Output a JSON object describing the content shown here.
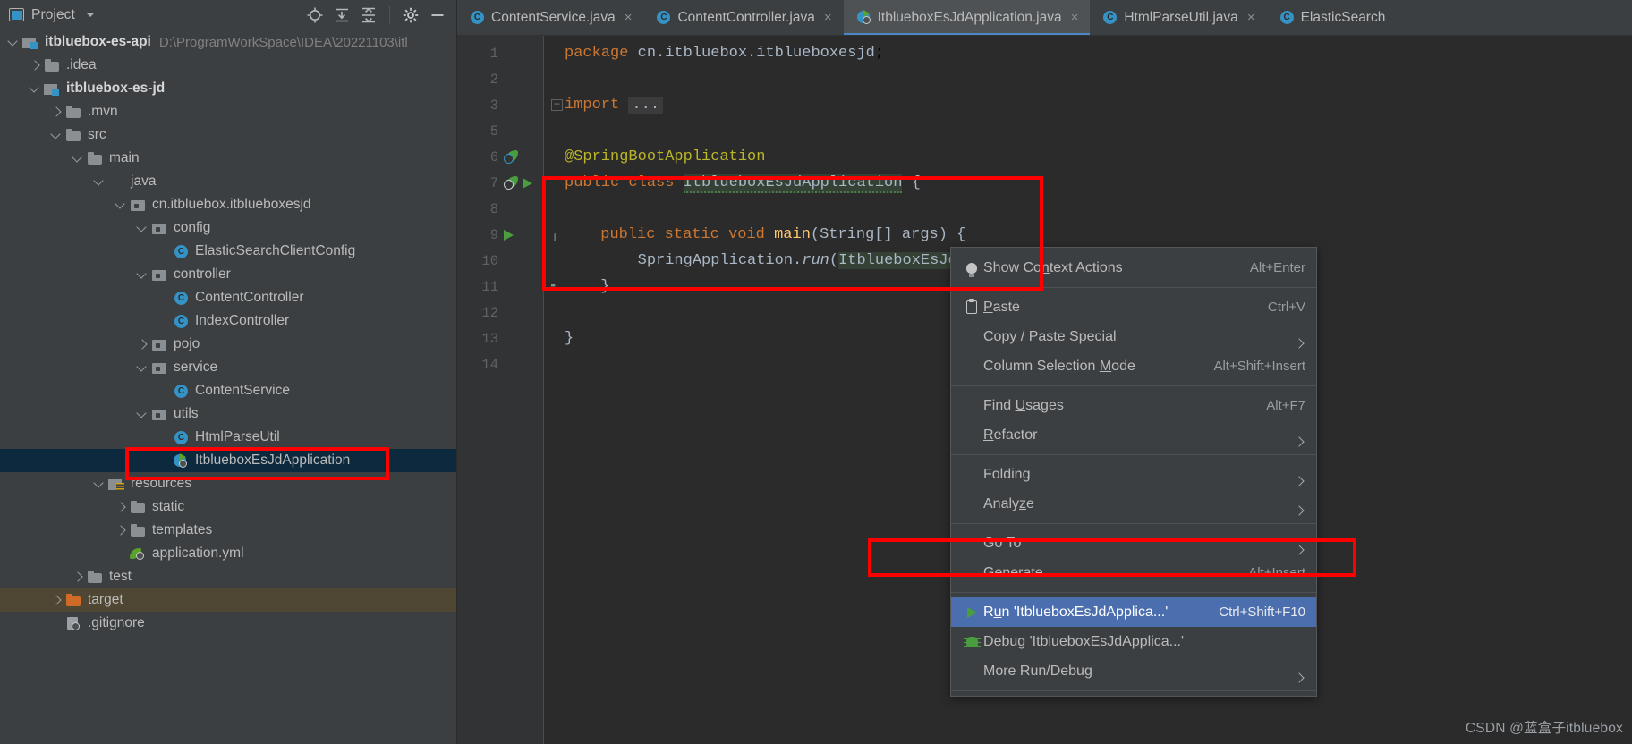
{
  "project_panel": {
    "title": "Project",
    "title_icon": "project-view-icon",
    "toolbar": [
      {
        "name": "locate-icon",
        "label": ""
      },
      {
        "name": "expand-all-icon",
        "label": ""
      },
      {
        "name": "collapse-all-icon",
        "label": ""
      },
      {
        "name": "gear-icon",
        "label": ""
      },
      {
        "name": "minimize-icon",
        "label": ""
      }
    ],
    "tree": [
      {
        "indent": 0,
        "arrow": "open",
        "icon": "module",
        "label": "itbluebox-es-api",
        "bold": true,
        "path": "D:\\ProgramWorkSpace\\IDEA\\20221103\\itl"
      },
      {
        "indent": 1,
        "arrow": "closed",
        "icon": "folder",
        "label": ".idea",
        "bold": false,
        "path": ""
      },
      {
        "indent": 1,
        "arrow": "open",
        "icon": "module",
        "label": "itbluebox-es-jd",
        "bold": true,
        "path": ""
      },
      {
        "indent": 2,
        "arrow": "closed",
        "icon": "folder",
        "label": ".mvn",
        "bold": false,
        "path": ""
      },
      {
        "indent": 2,
        "arrow": "open",
        "icon": "folder",
        "label": "src",
        "bold": false,
        "path": ""
      },
      {
        "indent": 3,
        "arrow": "open",
        "icon": "folder",
        "label": "main",
        "bold": false,
        "path": ""
      },
      {
        "indent": 4,
        "arrow": "open",
        "icon": "folder-blue",
        "label": "java",
        "bold": false,
        "path": ""
      },
      {
        "indent": 5,
        "arrow": "open",
        "icon": "pkg",
        "label": "cn.itbluebox.itblueboxesjd",
        "bold": false,
        "path": ""
      },
      {
        "indent": 6,
        "arrow": "open",
        "icon": "pkg",
        "label": "config",
        "bold": false,
        "path": ""
      },
      {
        "indent": 7,
        "arrow": "none",
        "icon": "cls",
        "label": "ElasticSearchClientConfig",
        "bold": false,
        "path": ""
      },
      {
        "indent": 6,
        "arrow": "open",
        "icon": "pkg",
        "label": "controller",
        "bold": false,
        "path": ""
      },
      {
        "indent": 7,
        "arrow": "none",
        "icon": "cls",
        "label": "ContentController",
        "bold": false,
        "path": ""
      },
      {
        "indent": 7,
        "arrow": "none",
        "icon": "cls",
        "label": "IndexController",
        "bold": false,
        "path": ""
      },
      {
        "indent": 6,
        "arrow": "closed",
        "icon": "pkg",
        "label": "pojo",
        "bold": false,
        "path": ""
      },
      {
        "indent": 6,
        "arrow": "open",
        "icon": "pkg",
        "label": "service",
        "bold": false,
        "path": ""
      },
      {
        "indent": 7,
        "arrow": "none",
        "icon": "cls",
        "label": "ContentService",
        "bold": false,
        "path": ""
      },
      {
        "indent": 6,
        "arrow": "open",
        "icon": "pkg",
        "label": "utils",
        "bold": false,
        "path": ""
      },
      {
        "indent": 7,
        "arrow": "none",
        "icon": "cls",
        "label": "HtmlParseUtil",
        "bold": false,
        "path": ""
      },
      {
        "indent": 7,
        "arrow": "none",
        "icon": "spring",
        "label": "ItblueboxEsJdApplication",
        "bold": false,
        "path": "",
        "selected": true
      },
      {
        "indent": 4,
        "arrow": "open",
        "icon": "resfolder",
        "label": "resources",
        "bold": false,
        "path": ""
      },
      {
        "indent": 5,
        "arrow": "closed",
        "icon": "folder",
        "label": "static",
        "bold": false,
        "path": ""
      },
      {
        "indent": 5,
        "arrow": "closed",
        "icon": "folder",
        "label": "templates",
        "bold": false,
        "path": ""
      },
      {
        "indent": 5,
        "arrow": "none",
        "icon": "yml",
        "label": "application.yml",
        "bold": false,
        "path": ""
      },
      {
        "indent": 3,
        "arrow": "closed",
        "icon": "folder",
        "label": "test",
        "bold": false,
        "path": ""
      },
      {
        "indent": 2,
        "arrow": "closed",
        "icon": "folder-orange",
        "label": "target",
        "bold": false,
        "path": "",
        "excluded": true
      },
      {
        "indent": 2,
        "arrow": "none",
        "icon": "gitig",
        "label": ".gitignore",
        "bold": false,
        "path": ""
      }
    ]
  },
  "tabs": [
    {
      "icon": "java-class-icon",
      "label": "ContentService.java",
      "active": false,
      "close": "×"
    },
    {
      "icon": "java-class-icon",
      "label": "ContentController.java",
      "active": false,
      "close": "×"
    },
    {
      "icon": "spring-boot-icon",
      "label": "ItblueboxEsJdApplication.java",
      "active": true,
      "close": "×"
    },
    {
      "icon": "java-class-icon",
      "label": "HtmlParseUtil.java",
      "active": false,
      "close": "×"
    },
    {
      "icon": "java-class-icon",
      "label": "ElasticSearch",
      "active": false,
      "close": ""
    }
  ],
  "editor": {
    "lines": [
      {
        "num": "1",
        "gutter_icons": [],
        "fold": "",
        "code_html": "<span class=\"kw\">package</span> <span class=\"id\">cn.itbluebox.itblueboxesjd</span>;"
      },
      {
        "num": "2",
        "gutter_icons": [],
        "fold": "",
        "code_html": ""
      },
      {
        "num": "3",
        "gutter_icons": [],
        "fold": "plus",
        "code_html": "<span class=\"kw\">import</span> <span class=\"folded\">...</span>"
      },
      {
        "num": "5",
        "gutter_icons": [],
        "fold": "",
        "code_html": ""
      },
      {
        "num": "6",
        "gutter_icons": [
          "bean-blue"
        ],
        "fold": "",
        "code_html": "<span class=\"ann\">@SpringBootApplication</span>"
      },
      {
        "num": "7",
        "gutter_icons": [
          "bean",
          "run"
        ],
        "fold": "",
        "code_html": "<span class=\"kw\">public class </span><span class=\"cls2 hl-green squiggle\">ItblueboxEsJdApplication</span><span class=\"id\"> {</span>"
      },
      {
        "num": "8",
        "gutter_icons": [],
        "fold": "",
        "code_html": ""
      },
      {
        "num": "9",
        "gutter_icons": [
          "run"
        ],
        "fold": "brace",
        "code_html": "    <span class=\"kw\">public static void </span><span class=\"mth\">main</span><span class=\"id\">(String[] args) {</span>"
      },
      {
        "num": "10",
        "gutter_icons": [],
        "fold": "",
        "code_html": "        <span class=\"id\">SpringApplication.</span><span class=\"ital\">run</span><span class=\"id\">(</span><span class=\"id hl-green\">ItblueboxEsJdApplication.</span><span class=\"id\">class, args);</span>"
      },
      {
        "num": "11",
        "gutter_icons": [],
        "fold": "brace-end",
        "code_html": "    <span class=\"id\">}</span>"
      },
      {
        "num": "12",
        "gutter_icons": [],
        "fold": "",
        "code_html": ""
      },
      {
        "num": "13",
        "gutter_icons": [],
        "fold": "",
        "code_html": "<span class=\"id\">}</span>"
      },
      {
        "num": "14",
        "gutter_icons": [],
        "fold": "",
        "code_html": ""
      }
    ]
  },
  "context_menu": {
    "items": [
      {
        "type": "item",
        "icon": "lightbulb-icon",
        "label_html": "Show Co<span class=\"u\">n</span>text Actions",
        "label": "Show Context Actions",
        "shortcut": "Alt+Enter",
        "submenu": false,
        "highlighted": false
      },
      {
        "type": "sep"
      },
      {
        "type": "item",
        "icon": "clipboard-icon",
        "label_html": "<span class=\"u\">P</span>aste",
        "label": "Paste",
        "shortcut": "Ctrl+V",
        "submenu": false,
        "highlighted": false
      },
      {
        "type": "item",
        "icon": "",
        "label_html": "Copy / Paste Special",
        "label": "Copy / Paste Special",
        "shortcut": "",
        "submenu": true,
        "highlighted": false
      },
      {
        "type": "item",
        "icon": "",
        "label_html": "Column Selection <span class=\"u\">M</span>ode",
        "label": "Column Selection Mode",
        "shortcut": "Alt+Shift+Insert",
        "submenu": false,
        "highlighted": false
      },
      {
        "type": "sep"
      },
      {
        "type": "item",
        "icon": "",
        "label_html": "Find <span class=\"u\">U</span>sages",
        "label": "Find Usages",
        "shortcut": "Alt+F7",
        "submenu": false,
        "highlighted": false
      },
      {
        "type": "item",
        "icon": "",
        "label_html": "<span class=\"u\">R</span>efactor",
        "label": "Refactor",
        "shortcut": "",
        "submenu": true,
        "highlighted": false
      },
      {
        "type": "sep"
      },
      {
        "type": "item",
        "icon": "",
        "label_html": "Folding",
        "label": "Folding",
        "shortcut": "",
        "submenu": true,
        "highlighted": false
      },
      {
        "type": "item",
        "icon": "",
        "label_html": "Analy<span class=\"u\">z</span>e",
        "label": "Analyze",
        "shortcut": "",
        "submenu": true,
        "highlighted": false
      },
      {
        "type": "sep"
      },
      {
        "type": "item",
        "icon": "",
        "label_html": "Go To",
        "label": "Go To",
        "shortcut": "",
        "submenu": true,
        "highlighted": false
      },
      {
        "type": "item",
        "icon": "",
        "label_html": "Generate...",
        "label": "Generate...",
        "shortcut": "Alt+Insert",
        "submenu": false,
        "highlighted": false
      },
      {
        "type": "sep"
      },
      {
        "type": "item",
        "icon": "run-icon",
        "label_html": "R<span class=\"u\">u</span>n 'ItblueboxEsJdApplica...'",
        "label": "Run 'ItblueboxEsJdApplica...'",
        "shortcut": "Ctrl+Shift+F10",
        "submenu": false,
        "highlighted": true
      },
      {
        "type": "item",
        "icon": "debug-icon",
        "label_html": "<span class=\"u\">D</span>ebug 'ItblueboxEsJdApplica...'",
        "label": "Debug 'ItblueboxEsJdApplica...'",
        "shortcut": "",
        "submenu": false,
        "highlighted": false
      },
      {
        "type": "item",
        "icon": "",
        "label_html": "More Run/Debug",
        "label": "More Run/Debug",
        "shortcut": "",
        "submenu": true,
        "highlighted": false
      },
      {
        "type": "sep"
      }
    ]
  },
  "annotations": {
    "color": "#fe0000",
    "boxes": [
      "tree-selected-file",
      "code-main-method",
      "run-menu-item"
    ]
  },
  "watermark": "CSDN @蓝盒子itbluebox"
}
